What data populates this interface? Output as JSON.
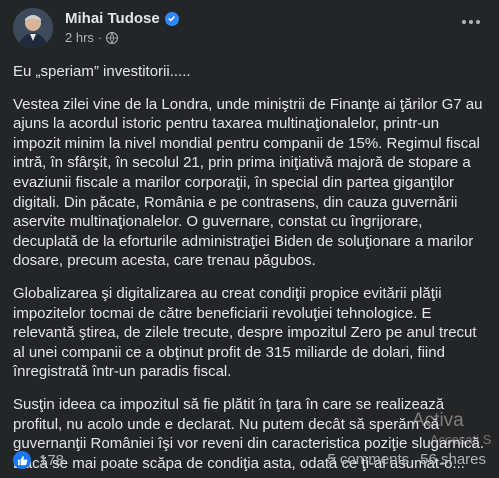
{
  "author": {
    "name": "Mihai Tudose",
    "time": "2 hrs"
  },
  "post": {
    "p1": "Eu „speriam” investitorii.....",
    "p2": "Vestea zilei vine de la Londra, unde miniştrii de Finanţe ai ţărilor G7 au ajuns la acordul istoric pentru taxarea multinaţionalelor, printr-un impozit minim la nivel mondial pentru companii de 15%. Regimul fiscal intră, în sfârşit, în secolul 21, prin prima iniţiativă majoră de stopare a evaziunii fiscale a marilor corporaţii, în special din partea giganţilor digitali. Din păcate, România e pe contrasens, din cauza guvernării aservite multinaţionalelor. O guvernare, constat cu îngrijorare, decuplată de la eforturile administraţiei Biden de soluţionare a marilor dosare, precum acesta, care trenau păgubos.",
    "p3": "Globalizarea şi digitalizarea au creat condiţii propice evitării plăţii impozitelor tocmai de către beneficiarii revoluţiei tehnologice. E relevantă ştirea, de zilele trecute, despre impozitul Zero pe anul trecut al unei companii ce a obţinut profit de 315 miliarde de dolari, fiind înregistrată într-un paradis fiscal.",
    "p4": "Susţin ideea ca impozitul să fie plătit în ţara în care se realizează profitul, nu acolo unde e declarat. Nu putem decât să sperăm că guvernanţii României îşi vor reveni din caracteristica poziţie slugarnică. Dacă se mai poate scăpa de condiţia asta, odată ce ţi-ai asumat-o..."
  },
  "footer": {
    "likes": "178",
    "comments": "5 comments",
    "shares": "56 shares"
  },
  "watermark": {
    "line1": "Activa",
    "line2": "Accesați S"
  },
  "colors": {
    "background": "#242526",
    "text": "#e4e6eb",
    "secondary": "#b0b3b8",
    "accent": "#2d88ff"
  }
}
